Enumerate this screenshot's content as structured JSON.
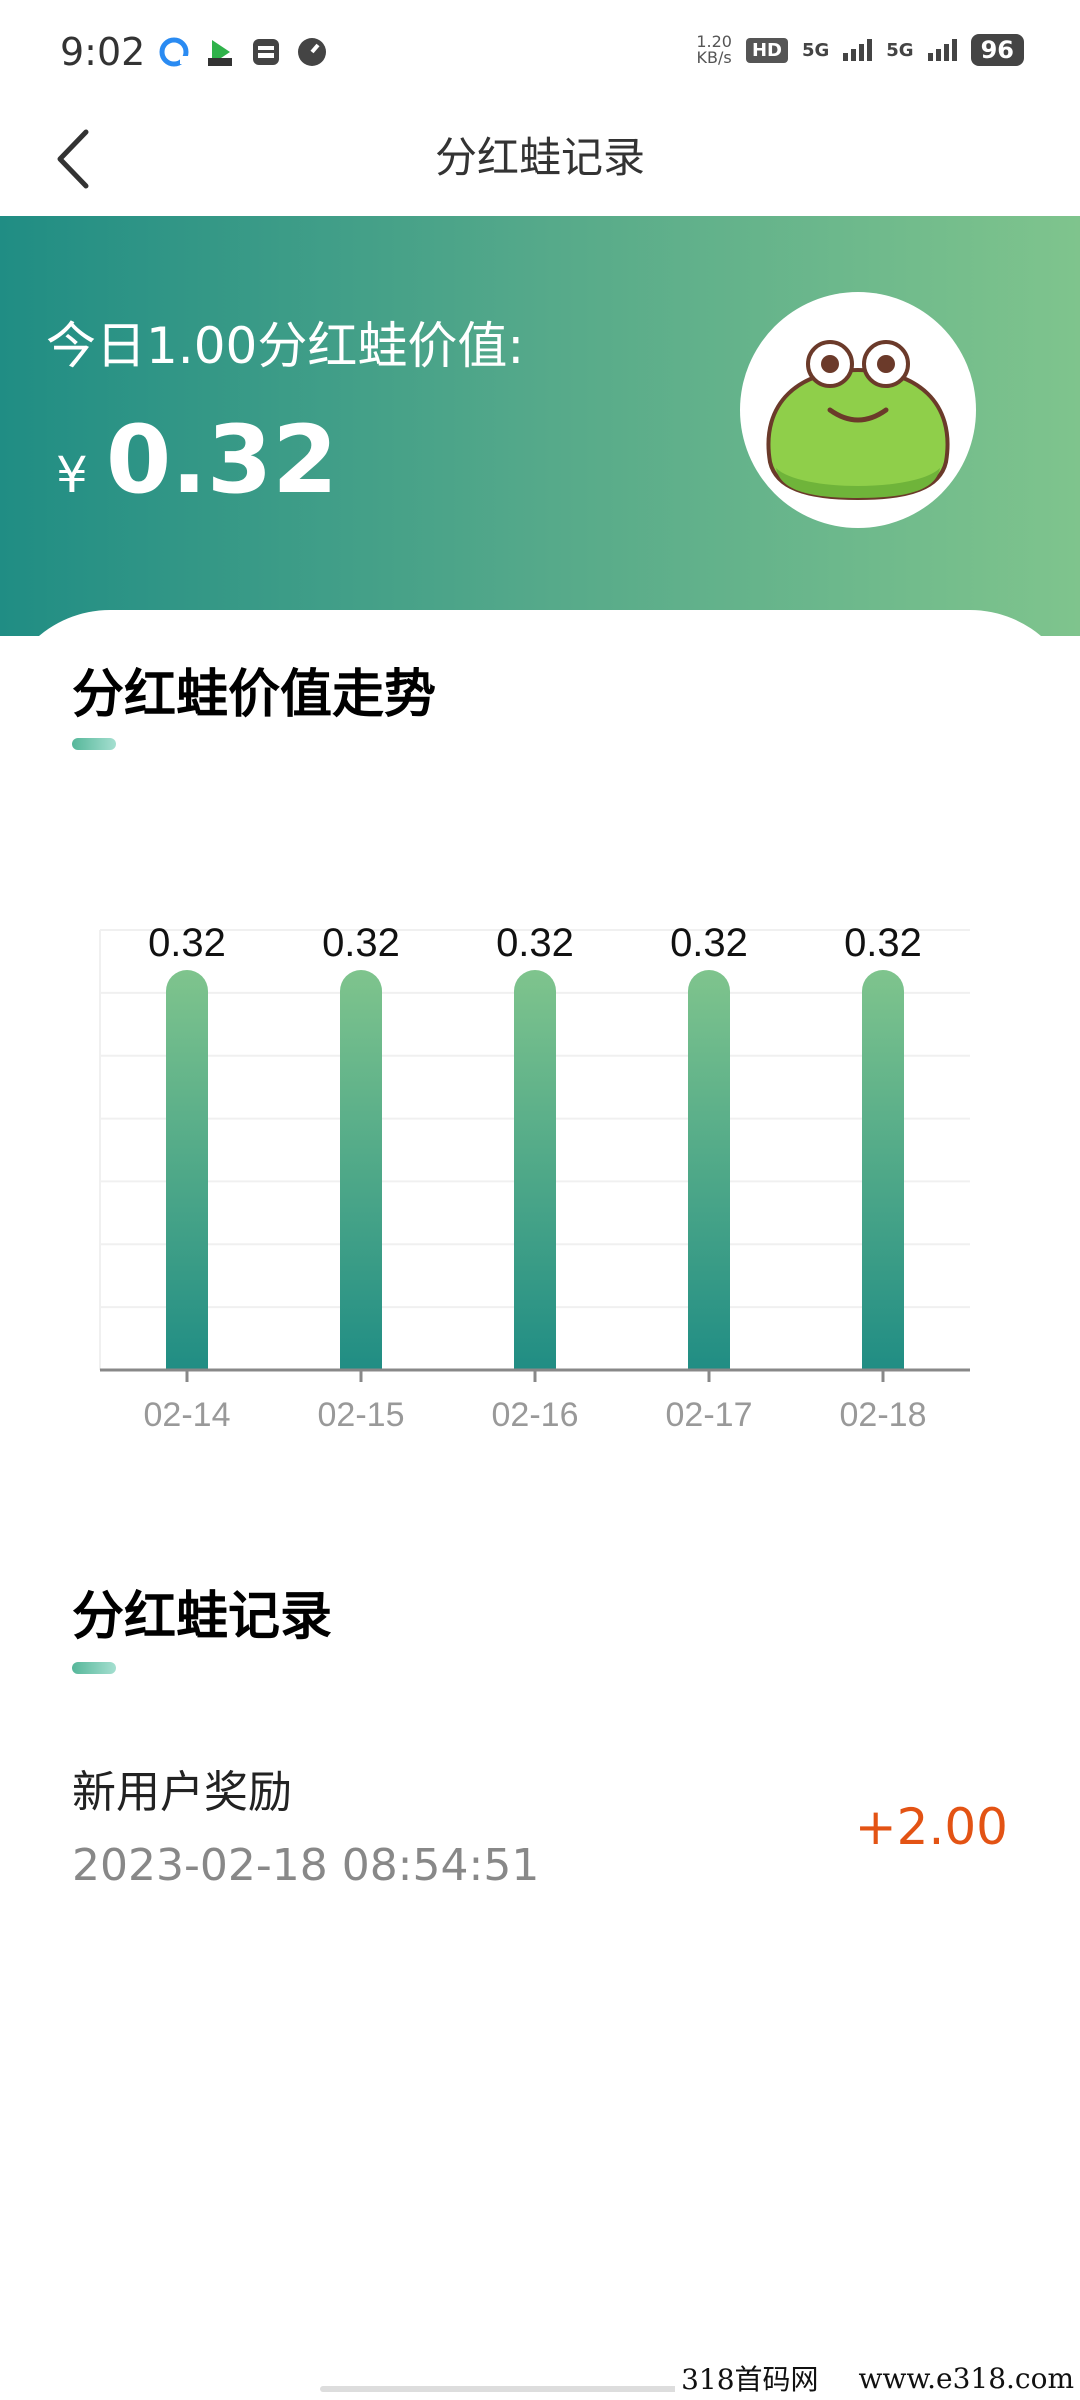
{
  "status_bar": {
    "time": "9:02",
    "net_speed_value": "1.20",
    "net_speed_unit": "KB/s",
    "hd_label": "HD",
    "sim1_label": "5G",
    "sim2_label": "5G",
    "battery": "96"
  },
  "nav": {
    "title": "分红蛙记录"
  },
  "header": {
    "label": "今日1.00分红蛙价值:",
    "currency": "¥",
    "value": "0.32"
  },
  "trend_section": {
    "title": "分红蛙价值走势"
  },
  "chart_data": {
    "type": "bar",
    "categories": [
      "02-14",
      "02-15",
      "02-16",
      "02-17",
      "02-18"
    ],
    "values": [
      0.32,
      0.32,
      0.32,
      0.32,
      0.32
    ],
    "data_labels": [
      "0.32",
      "0.32",
      "0.32",
      "0.32",
      "0.32"
    ],
    "title": "",
    "xlabel": "",
    "ylabel": "",
    "ylim": [
      0,
      0.352
    ],
    "grid": true,
    "legend": "none",
    "bar_color_top": "#7fc48d",
    "bar_color_bottom": "#208d84"
  },
  "records_section": {
    "title": "分红蛙记录",
    "items": [
      {
        "name": "新用户奖励",
        "time": "2023-02-18 08:54:51",
        "amount": "+2.00"
      }
    ]
  },
  "watermark": {
    "name": "318首码网",
    "url": "www.e318.com"
  },
  "colors": {
    "accent": "#208d84",
    "gradient_end": "#7fc48d",
    "amount": "#e35314"
  }
}
